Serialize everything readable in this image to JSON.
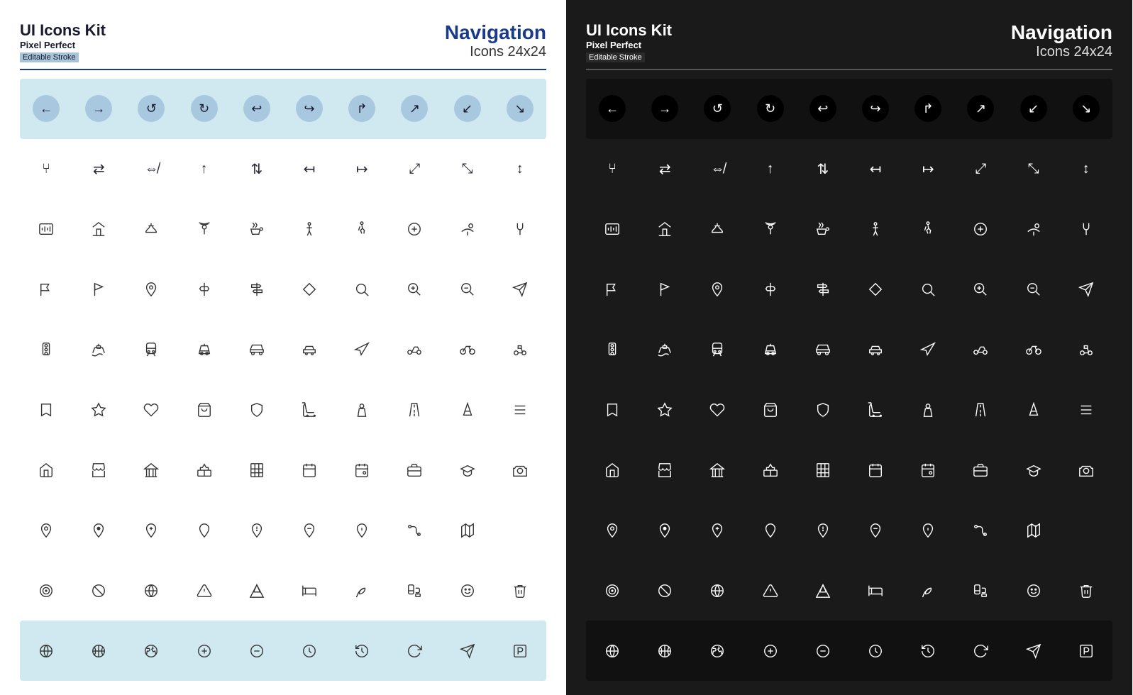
{
  "light_panel": {
    "kit_title": "UI Icons Kit",
    "pixel_perfect": "Pixel Perfect",
    "editable_stroke": "Editable Stroke",
    "nav_title": "Navigation",
    "icons_size": "Icons 24x24",
    "theme": "light"
  },
  "dark_panel": {
    "kit_title": "UI Icons Kit",
    "pixel_perfect": "Pixel Perfect",
    "editable_stroke": "Editable Stroke",
    "nav_title": "Navigation",
    "icons_size": "Icons 24x24",
    "theme": "dark"
  },
  "icon_rows": [
    {
      "type": "circles",
      "icons": [
        "←",
        "→",
        "↺",
        "↻",
        "↩",
        "↪",
        "↱",
        "↗",
        "↙",
        "↘"
      ]
    },
    {
      "type": "normal",
      "icons": [
        "⑂",
        "⇌",
        "⇎",
        "↑",
        "⇅",
        "↤",
        "↦",
        "⤢",
        "⤡",
        "↕"
      ]
    },
    {
      "type": "normal",
      "icons": [
        "🖥",
        "🏠",
        "⚖",
        "✳",
        "☕",
        "🚶",
        "🚶",
        "🩺",
        "☂",
        "🍴"
      ]
    },
    {
      "type": "normal",
      "icons": [
        "⚑",
        "⛳",
        "○",
        "▷",
        "≡",
        "◇",
        "🔍",
        "⊕",
        "⊖",
        "✈"
      ]
    },
    {
      "type": "normal",
      "icons": [
        "🚦",
        "⛴",
        "🚂",
        "🚎",
        "🚐",
        "🚗",
        "✈",
        "🏍",
        "🚲",
        "🛴"
      ]
    },
    {
      "type": "normal",
      "icons": [
        "🔖",
        "★",
        "♡",
        "🛍",
        "🛡",
        "🛒",
        "⑧",
        "╱",
        "⚠",
        "🍔"
      ]
    },
    {
      "type": "normal",
      "icons": [
        "🏠",
        "🏪",
        "🏛",
        "🏗",
        "🏢",
        "📅",
        "📅",
        "💼",
        "🎓",
        "📷"
      ]
    },
    {
      "type": "normal",
      "icons": [
        "📍",
        "📍",
        "📍",
        "📍",
        "📍",
        "📍",
        "📍",
        "〰",
        "🗺",
        ""
      ]
    },
    {
      "type": "normal",
      "icons": [
        "◎",
        "⊘",
        "🗺",
        "⚠",
        "⛺",
        "🛏",
        "🌿",
        "🏠",
        "🎭",
        "🗑"
      ]
    },
    {
      "type": "circles_bottom",
      "icons": [
        "🌐",
        "🏀",
        "🌍",
        "⊕",
        "⊖",
        "🕐",
        "🕐",
        "↺",
        "✈",
        "P"
      ]
    }
  ]
}
